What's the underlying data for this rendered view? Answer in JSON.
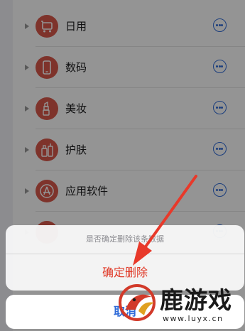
{
  "categories": [
    {
      "label": "日用",
      "icon": "cart-icon"
    },
    {
      "label": "数码",
      "icon": "phone-icon"
    },
    {
      "label": "美妆",
      "icon": "lipstick-icon"
    },
    {
      "label": "护肤",
      "icon": "skincare-icon"
    },
    {
      "label": "应用软件",
      "icon": "app-store-icon"
    }
  ],
  "action_sheet": {
    "message": "是否确定删除该条数据",
    "confirm_label": "确定删除",
    "cancel_label": "取消"
  },
  "watermark": {
    "brand": "鹿游戏",
    "url": "www.luyx.cn"
  },
  "colors": {
    "icon_bg": "#d9594b",
    "accent_blue": "#2f6bd8",
    "destructive_red": "#e03a28",
    "annotation_arrow": "#e8392a"
  }
}
